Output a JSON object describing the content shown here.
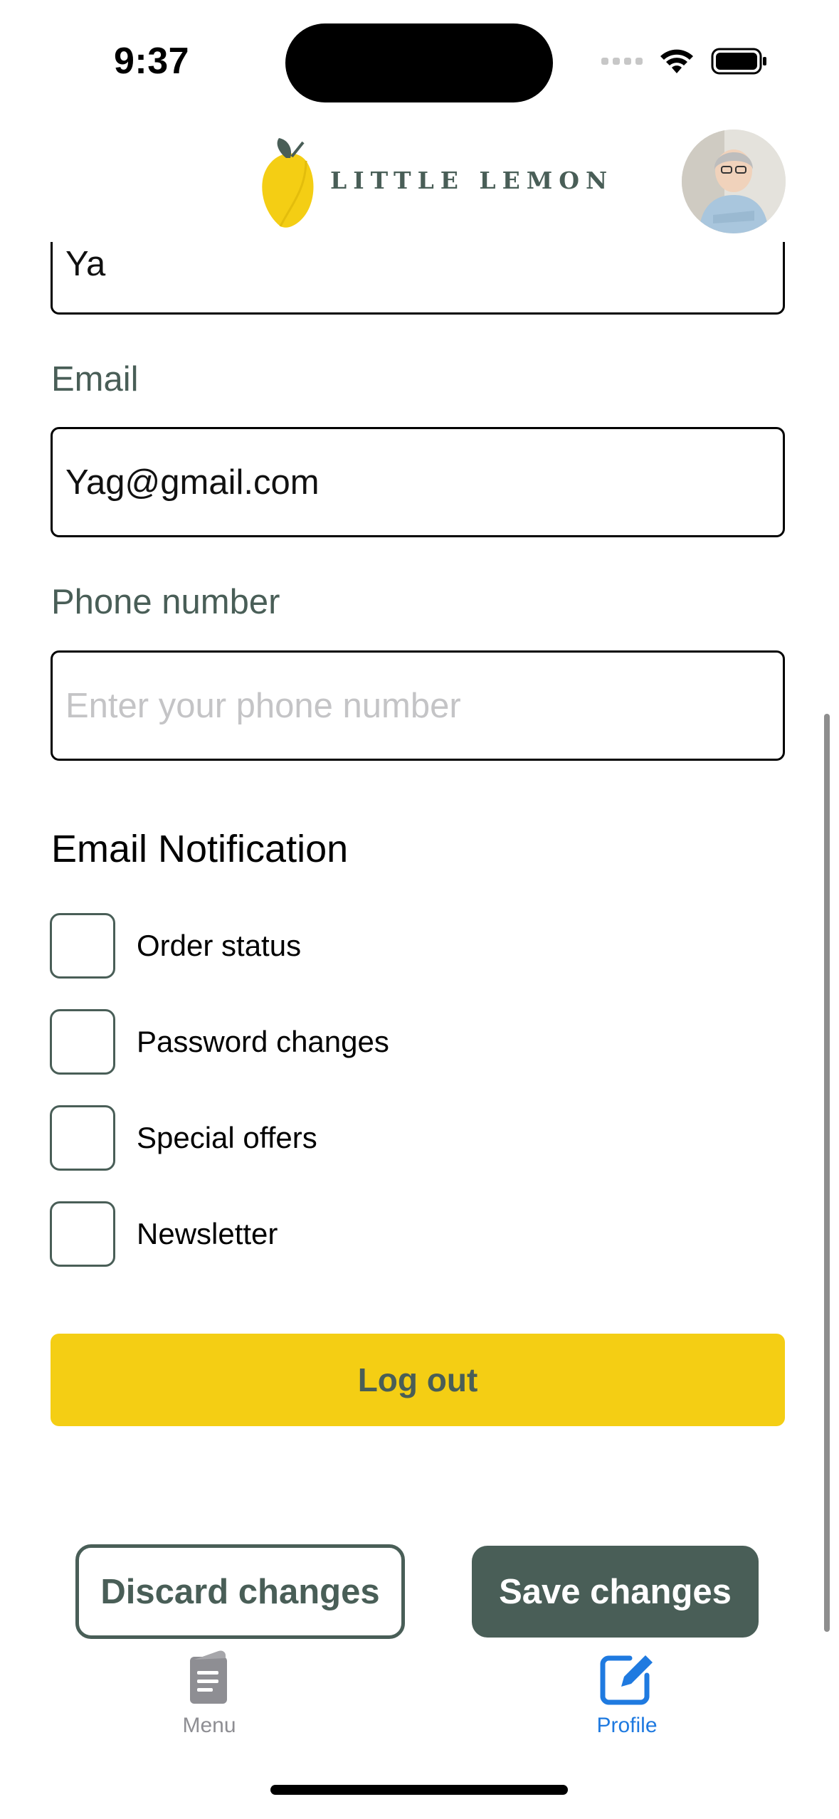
{
  "status_bar": {
    "time": "9:37"
  },
  "header": {
    "logo_text": "LITTLE LEMON",
    "avatar_icon": "profile-photo"
  },
  "form": {
    "last_name_value": "Ya",
    "email_label": "Email",
    "email_value": "Yag@gmail.com",
    "phone_label": "Phone number",
    "phone_placeholder": "Enter your phone number"
  },
  "notifications": {
    "title": "Email Notification",
    "options": [
      {
        "label": "Order status",
        "checked": false
      },
      {
        "label": "Password changes",
        "checked": false
      },
      {
        "label": "Special offers",
        "checked": false
      },
      {
        "label": "Newsletter",
        "checked": false
      }
    ]
  },
  "actions": {
    "logout_label": "Log out",
    "discard_label": "Discard changes",
    "save_label": "Save changes"
  },
  "tab_bar": {
    "items": [
      {
        "label": "Menu",
        "icon": "menu-document-icon",
        "active": false
      },
      {
        "label": "Profile",
        "icon": "edit-square-icon",
        "active": true
      }
    ]
  },
  "colors": {
    "primary_green": "#495e57",
    "primary_yellow": "#f4ce14",
    "active_tab_blue": "#1f7ae0",
    "inactive_tab_gray": "#8e8e93"
  }
}
